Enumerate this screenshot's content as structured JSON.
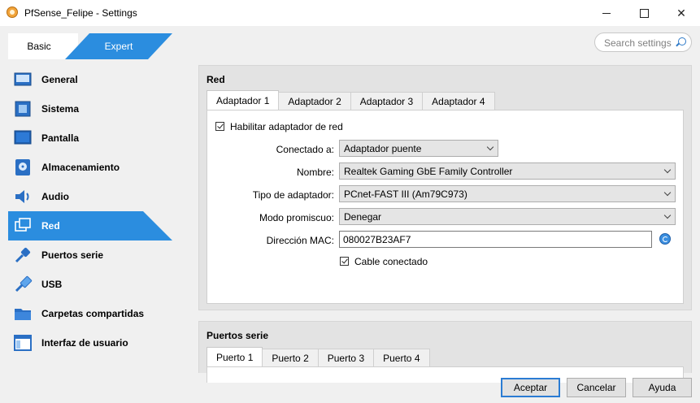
{
  "window": {
    "title": "PfSense_Felipe - Settings"
  },
  "mode": {
    "basic": "Basic",
    "expert": "Expert"
  },
  "search": {
    "placeholder": "Search settings"
  },
  "sidebar": {
    "items": [
      {
        "label": "General",
        "icon": "general-icon"
      },
      {
        "label": "Sistema",
        "icon": "system-icon"
      },
      {
        "label": "Pantalla",
        "icon": "display-icon"
      },
      {
        "label": "Almacenamiento",
        "icon": "storage-icon"
      },
      {
        "label": "Audio",
        "icon": "audio-icon"
      },
      {
        "label": "Red",
        "icon": "network-icon",
        "active": true
      },
      {
        "label": "Puertos serie",
        "icon": "serial-ports-icon"
      },
      {
        "label": "USB",
        "icon": "usb-icon"
      },
      {
        "label": "Carpetas compartidas",
        "icon": "shared-folders-icon"
      },
      {
        "label": "Interfaz de usuario",
        "icon": "user-interface-icon"
      }
    ]
  },
  "network": {
    "title": "Red",
    "tabs": [
      "Adaptador 1",
      "Adaptador 2",
      "Adaptador 3",
      "Adaptador 4"
    ],
    "enable_label": "Habilitar adaptador de red",
    "attached_label": "Conectado a:",
    "attached_value": "Adaptador puente",
    "name_label": "Nombre:",
    "name_value": "Realtek Gaming GbE Family Controller",
    "adapter_type_label": "Tipo de adaptador:",
    "adapter_type_value": "PCnet-FAST III (Am79C973)",
    "promisc_label": "Modo promiscuo:",
    "promisc_value": "Denegar",
    "mac_label": "Dirección MAC:",
    "mac_value": "080027B23AF7",
    "cable_label": "Cable conectado"
  },
  "serial": {
    "title": "Puertos serie",
    "tabs": [
      "Puerto 1",
      "Puerto 2",
      "Puerto 3",
      "Puerto 4"
    ]
  },
  "buttons": {
    "ok": "Aceptar",
    "cancel": "Cancelar",
    "help": "Ayuda"
  },
  "colors": {
    "accent": "#2b8ddf"
  }
}
